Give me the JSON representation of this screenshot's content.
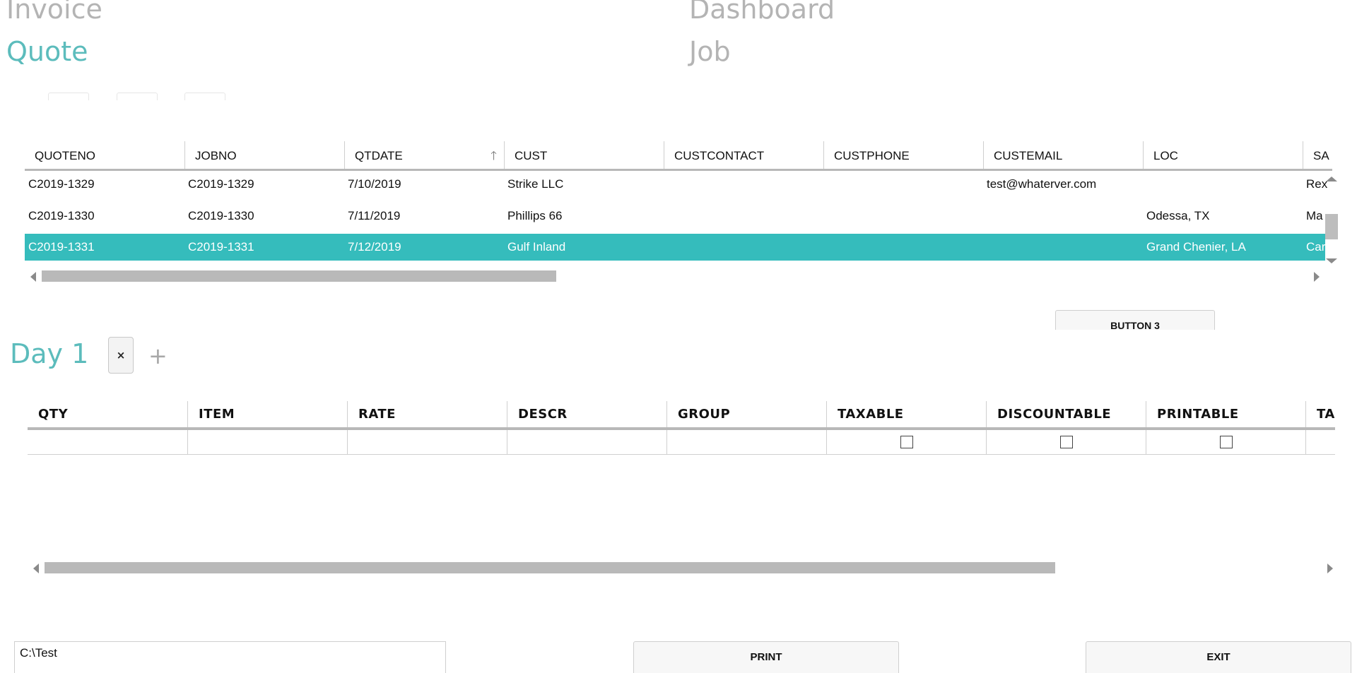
{
  "nav": {
    "invoice": "Invoice",
    "dashboard": "Dashboard",
    "quote": "Quote",
    "job": "Job"
  },
  "quotes_grid": {
    "columns": [
      "QUOTENO",
      "JOBNO",
      "QTDATE",
      "CUST",
      "CUSTCONTACT",
      "CUSTPHONE",
      "CUSTEMAIL",
      "LOC",
      "SA"
    ],
    "sort_icon": "sort-up-arrow-icon",
    "rows": [
      {
        "quoteno": "C2019-1329",
        "jobno": "C2019-1329",
        "qtdate": "7/10/2019",
        "cust": "Strike LLC",
        "custcontact": "",
        "custphone": "",
        "custemail": "test@whaterver.com",
        "loc": "",
        "sa": "Rex"
      },
      {
        "quoteno": "C2019-1330",
        "jobno": "C2019-1330",
        "qtdate": "7/11/2019",
        "cust": "Phillips 66",
        "custcontact": "",
        "custphone": "",
        "custemail": "",
        "loc": "Odessa, TX",
        "sa": "Ma"
      },
      {
        "quoteno": "C2019-1331",
        "jobno": "C2019-1331",
        "qtdate": "7/12/2019",
        "cust": "Gulf Inland",
        "custcontact": "",
        "custphone": "",
        "custemail": "",
        "loc": "Grand Chenier, LA",
        "sa": "Car"
      }
    ],
    "selected_row": 2
  },
  "button3": {
    "label": "BUTTON 3"
  },
  "day_tabs": {
    "active_label": "Day 1",
    "close_glyph": "×",
    "add_glyph": "+"
  },
  "items_grid": {
    "columns": [
      "QTY",
      "ITEM",
      "RATE",
      "DESCR",
      "GROUP",
      "TAXABLE",
      "DISCOUNTABLE",
      "PRINTABLE",
      "TA"
    ]
  },
  "footer": {
    "path_value": "C:\\Test",
    "print_label": "PRINT",
    "exit_label": "EXIT"
  },
  "colors": {
    "accent": "#5cbcbc",
    "selection": "#35bcbc",
    "nav_inactive": "#b4b4b4"
  }
}
